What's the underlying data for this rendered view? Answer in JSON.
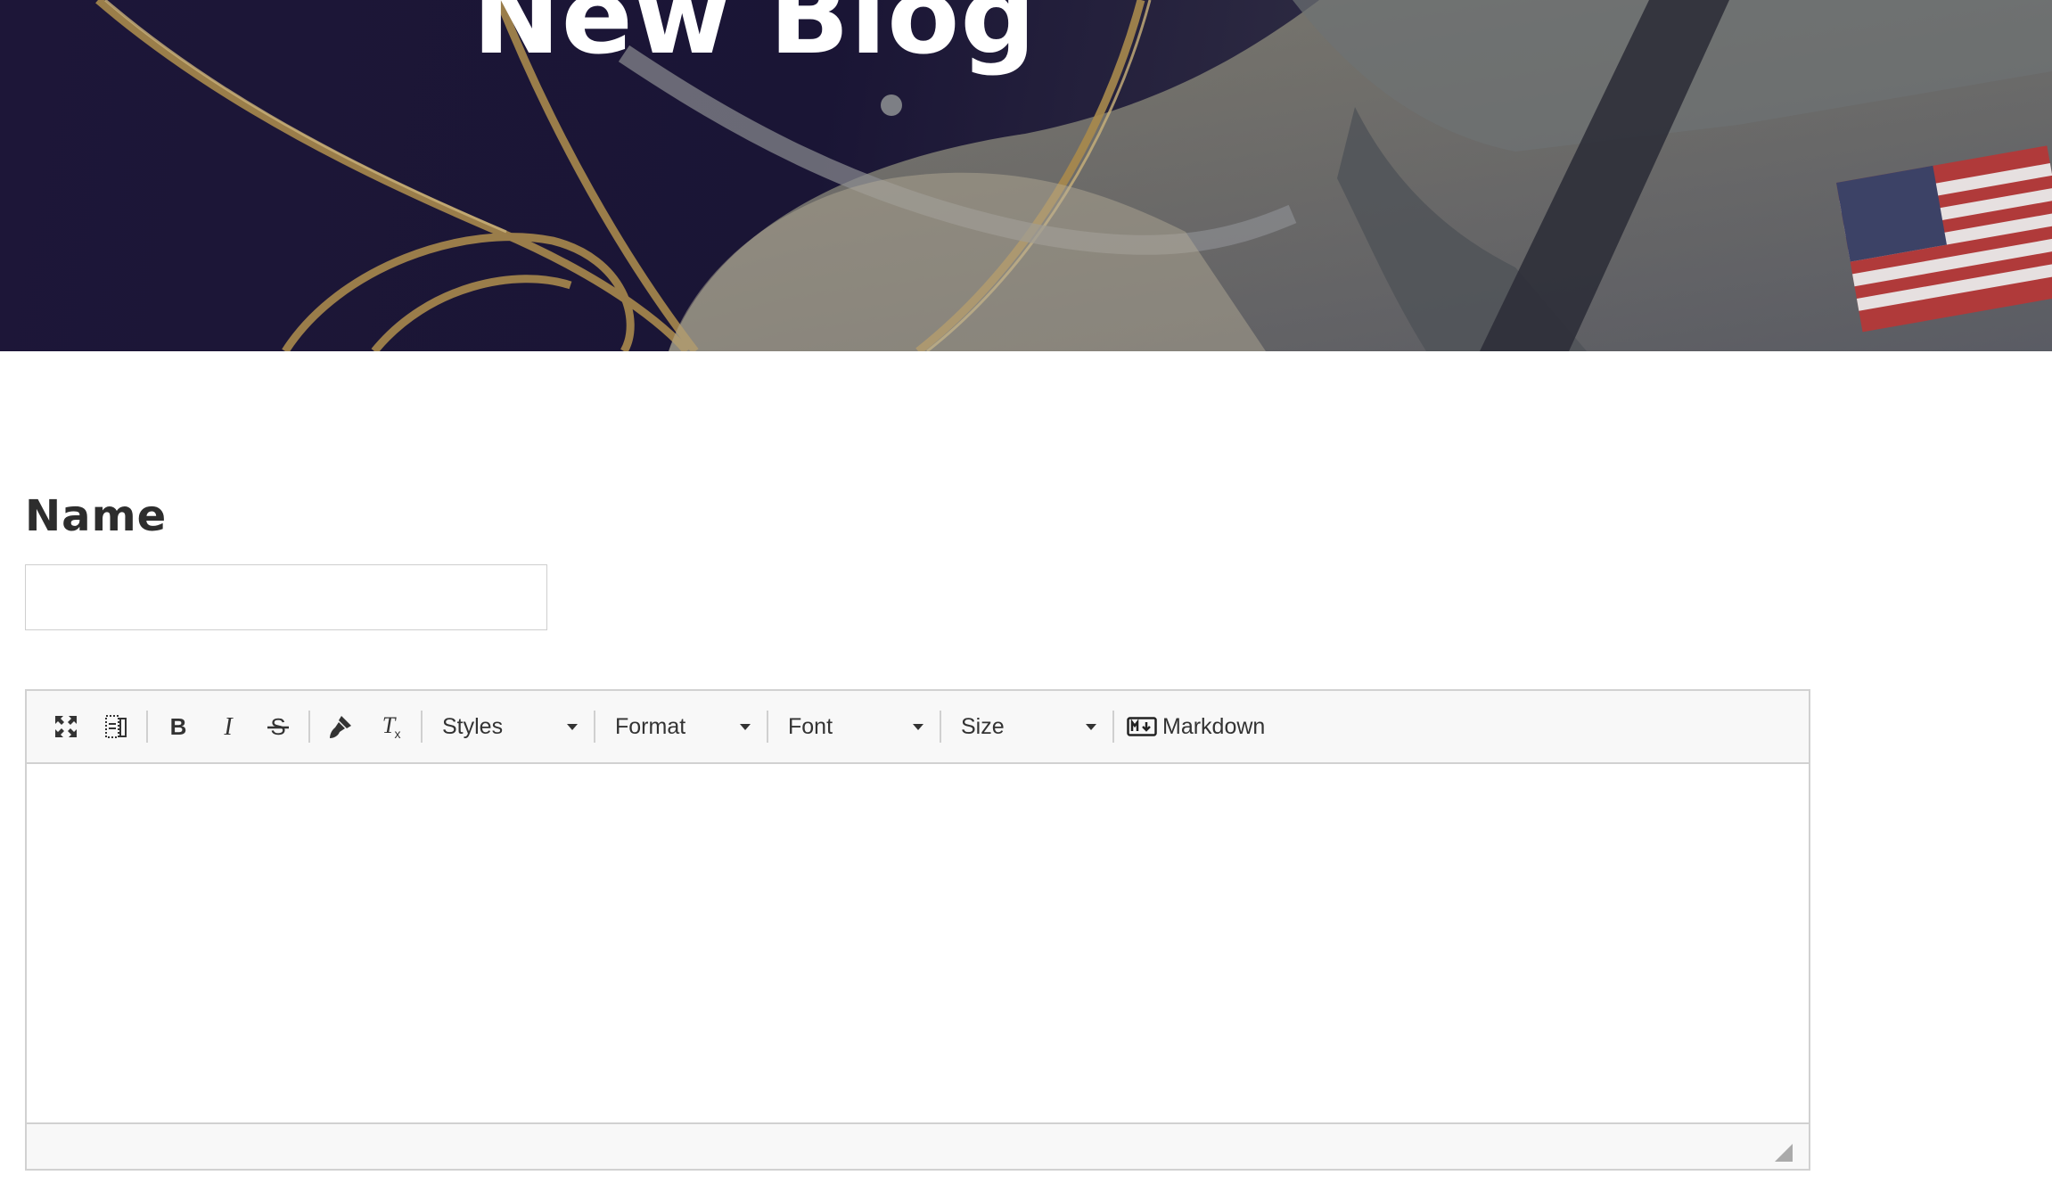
{
  "hero": {
    "title": "New Blog"
  },
  "form": {
    "name_label": "Name",
    "name_value": "",
    "name_placeholder": ""
  },
  "editor": {
    "toolbar": {
      "maximize_icon": "maximize-icon",
      "showblocks_icon": "show-blocks-icon",
      "bold_icon": "bold-icon",
      "italic_icon": "italic-icon",
      "strike_icon": "strikethrough-icon",
      "copyformat_icon": "paintbrush-icon",
      "removeformat_icon": "remove-format-icon",
      "combos": [
        {
          "label": "Styles"
        },
        {
          "label": "Format"
        },
        {
          "label": "Font"
        },
        {
          "label": "Size"
        }
      ],
      "markdown_label": "Markdown"
    },
    "content": ""
  },
  "colors": {
    "hero_background": "#1d1638",
    "heading_text": "#2d2d2d",
    "toolbar_background": "#f8f8f8",
    "border": "#d1d1d1"
  }
}
